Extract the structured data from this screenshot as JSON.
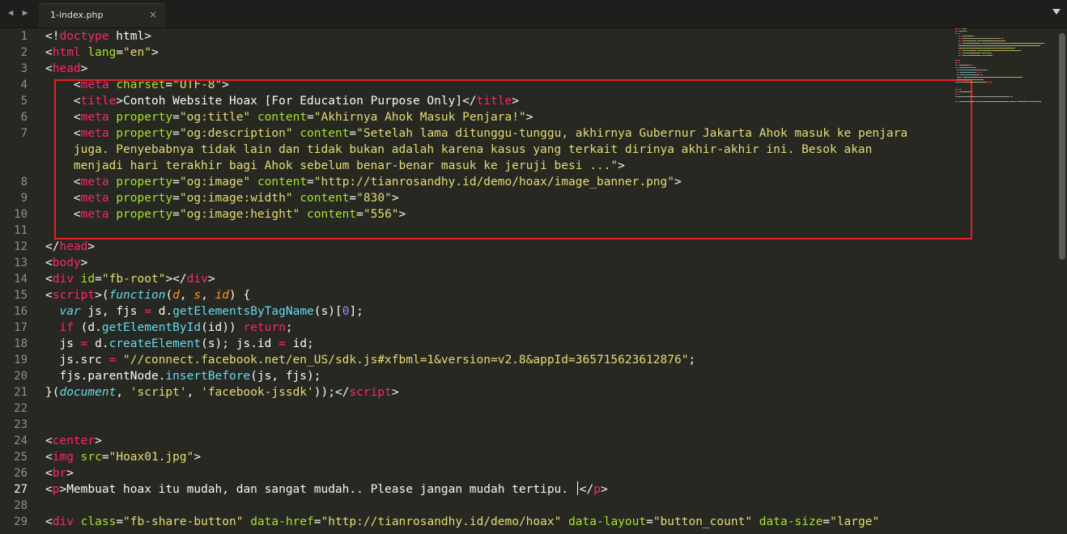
{
  "tab": {
    "filename": "1-index.php",
    "close_glyph": "×"
  },
  "line_numbers": [
    "1",
    "2",
    "3",
    "4",
    "5",
    "6",
    "7",
    "",
    "",
    "8",
    "9",
    "10",
    "11",
    "12",
    "13",
    "14",
    "15",
    "16",
    "17",
    "18",
    "19",
    "20",
    "21",
    "22",
    "23",
    "24",
    "25",
    "26",
    "27",
    "28",
    "29"
  ],
  "active_line_number": "27",
  "code_lines": [
    [
      [
        "p",
        "<!"
      ],
      [
        "t",
        "doctype"
      ],
      [
        "p",
        " html>"
      ]
    ],
    [
      [
        "p",
        "<"
      ],
      [
        "t",
        "html"
      ],
      [
        "p",
        " "
      ],
      [
        "a",
        "lang"
      ],
      [
        "p",
        "="
      ],
      [
        "s",
        "\"en\""
      ],
      [
        "p",
        ">"
      ]
    ],
    [
      [
        "p",
        "<"
      ],
      [
        "t",
        "head"
      ],
      [
        "p",
        ">"
      ]
    ],
    [
      [
        "p",
        "    <"
      ],
      [
        "t",
        "meta"
      ],
      [
        "p",
        " "
      ],
      [
        "a",
        "charset"
      ],
      [
        "p",
        "="
      ],
      [
        "s",
        "\"UTF-8\""
      ],
      [
        "p",
        ">"
      ]
    ],
    [
      [
        "p",
        "    <"
      ],
      [
        "t",
        "title"
      ],
      [
        "p",
        ">Contoh Website Hoax [For Education Purpose Only]</"
      ],
      [
        "t",
        "title"
      ],
      [
        "p",
        ">"
      ]
    ],
    [
      [
        "p",
        "    <"
      ],
      [
        "t",
        "meta"
      ],
      [
        "p",
        " "
      ],
      [
        "a",
        "property"
      ],
      [
        "p",
        "="
      ],
      [
        "s",
        "\"og:title\""
      ],
      [
        "p",
        " "
      ],
      [
        "a",
        "content"
      ],
      [
        "p",
        "="
      ],
      [
        "s",
        "\"Akhirnya Ahok Masuk Penjara!\""
      ],
      [
        "p",
        ">"
      ]
    ],
    [
      [
        "p",
        "    <"
      ],
      [
        "t",
        "meta"
      ],
      [
        "p",
        " "
      ],
      [
        "a",
        "property"
      ],
      [
        "p",
        "="
      ],
      [
        "s",
        "\"og:description\""
      ],
      [
        "p",
        " "
      ],
      [
        "a",
        "content"
      ],
      [
        "p",
        "="
      ],
      [
        "s",
        "\"Setelah lama ditunggu-tunggu, akhirnya Gubernur Jakarta Ahok masuk ke penjara"
      ]
    ],
    [
      [
        "s",
        "    juga. Penyebabnya tidak lain dan tidak bukan adalah karena kasus yang terkait dirinya akhir-akhir ini. Besok akan"
      ]
    ],
    [
      [
        "s",
        "    menjadi hari terakhir bagi Ahok sebelum benar-benar masuk ke jeruji besi ...\""
      ],
      [
        "p",
        ">"
      ]
    ],
    [
      [
        "p",
        "    <"
      ],
      [
        "t",
        "meta"
      ],
      [
        "p",
        " "
      ],
      [
        "a",
        "property"
      ],
      [
        "p",
        "="
      ],
      [
        "s",
        "\"og:image\""
      ],
      [
        "p",
        " "
      ],
      [
        "a",
        "content"
      ],
      [
        "p",
        "="
      ],
      [
        "s",
        "\"http://tianrosandhy.id/demo/hoax/image_banner.png\""
      ],
      [
        "p",
        ">"
      ]
    ],
    [
      [
        "p",
        "    <"
      ],
      [
        "t",
        "meta"
      ],
      [
        "p",
        " "
      ],
      [
        "a",
        "property"
      ],
      [
        "p",
        "="
      ],
      [
        "s",
        "\"og:image:width\""
      ],
      [
        "p",
        " "
      ],
      [
        "a",
        "content"
      ],
      [
        "p",
        "="
      ],
      [
        "s",
        "\"830\""
      ],
      [
        "p",
        ">"
      ]
    ],
    [
      [
        "p",
        "    <"
      ],
      [
        "t",
        "meta"
      ],
      [
        "p",
        " "
      ],
      [
        "a",
        "property"
      ],
      [
        "p",
        "="
      ],
      [
        "s",
        "\"og:image:height\""
      ],
      [
        "p",
        " "
      ],
      [
        "a",
        "content"
      ],
      [
        "p",
        "="
      ],
      [
        "s",
        "\"556\""
      ],
      [
        "p",
        ">"
      ]
    ],
    [],
    [
      [
        "p",
        "</"
      ],
      [
        "t",
        "head"
      ],
      [
        "p",
        ">"
      ]
    ],
    [
      [
        "p",
        "<"
      ],
      [
        "t",
        "body"
      ],
      [
        "p",
        ">"
      ]
    ],
    [
      [
        "p",
        "<"
      ],
      [
        "t",
        "div"
      ],
      [
        "p",
        " "
      ],
      [
        "a",
        "id"
      ],
      [
        "p",
        "="
      ],
      [
        "s",
        "\"fb-root\""
      ],
      [
        "p",
        "></"
      ],
      [
        "t",
        "div"
      ],
      [
        "p",
        ">"
      ]
    ],
    [
      [
        "p",
        "<"
      ],
      [
        "t",
        "script"
      ],
      [
        "p",
        ">("
      ],
      [
        "k",
        "function"
      ],
      [
        "p",
        "("
      ],
      [
        "v",
        "d"
      ],
      [
        "p",
        ", "
      ],
      [
        "v",
        "s"
      ],
      [
        "p",
        ", "
      ],
      [
        "v",
        "id"
      ],
      [
        "p",
        ") {"
      ]
    ],
    [
      [
        "p",
        "  "
      ],
      [
        "k",
        "var"
      ],
      [
        "p",
        " js, fjs "
      ],
      [
        "r",
        "="
      ],
      [
        "p",
        " d."
      ],
      [
        "f",
        "getElementsByTagName"
      ],
      [
        "p",
        "(s)["
      ],
      [
        "n",
        "0"
      ],
      [
        "p",
        "];"
      ]
    ],
    [
      [
        "p",
        "  "
      ],
      [
        "r",
        "if"
      ],
      [
        "p",
        " (d."
      ],
      [
        "f",
        "getElementById"
      ],
      [
        "p",
        "(id)) "
      ],
      [
        "r",
        "return"
      ],
      [
        "p",
        ";"
      ]
    ],
    [
      [
        "p",
        "  js "
      ],
      [
        "r",
        "="
      ],
      [
        "p",
        " d."
      ],
      [
        "f",
        "createElement"
      ],
      [
        "p",
        "(s); js.id "
      ],
      [
        "r",
        "="
      ],
      [
        "p",
        " id;"
      ]
    ],
    [
      [
        "p",
        "  js.src "
      ],
      [
        "r",
        "="
      ],
      [
        "p",
        " "
      ],
      [
        "s",
        "\"//connect.facebook.net/en_US/sdk.js#xfbml=1&version=v2.8&appId=365715623612876\""
      ],
      [
        "p",
        ";"
      ]
    ],
    [
      [
        "p",
        "  fjs.parentNode."
      ],
      [
        "f",
        "insertBefore"
      ],
      [
        "p",
        "(js, fjs);"
      ]
    ],
    [
      [
        "p",
        "}("
      ],
      [
        "k",
        "document"
      ],
      [
        "p",
        ", "
      ],
      [
        "s",
        "'script'"
      ],
      [
        "p",
        ", "
      ],
      [
        "s",
        "'facebook-jssdk'"
      ],
      [
        "p",
        "));</"
      ],
      [
        "t",
        "script"
      ],
      [
        "p",
        ">"
      ]
    ],
    [],
    [],
    [
      [
        "p",
        "<"
      ],
      [
        "t",
        "center"
      ],
      [
        "p",
        ">"
      ]
    ],
    [
      [
        "p",
        "<"
      ],
      [
        "t",
        "img"
      ],
      [
        "p",
        " "
      ],
      [
        "a",
        "src"
      ],
      [
        "p",
        "="
      ],
      [
        "s",
        "\"Hoax01.jpg\""
      ],
      [
        "p",
        ">"
      ]
    ],
    [
      [
        "p",
        "<"
      ],
      [
        "t",
        "br"
      ],
      [
        "p",
        ">"
      ]
    ],
    [
      [
        "p",
        "<"
      ],
      [
        "t",
        "p"
      ],
      [
        "p",
        ">Membuat hoax itu mudah, dan sangat mudah.. Please jangan mudah tertipu. "
      ],
      [
        "c",
        ""
      ],
      [
        "p",
        "</"
      ],
      [
        "t",
        "p"
      ],
      [
        "p",
        ">"
      ]
    ],
    [],
    [
      [
        "p",
        "<"
      ],
      [
        "t",
        "div"
      ],
      [
        "p",
        " "
      ],
      [
        "a",
        "class"
      ],
      [
        "p",
        "="
      ],
      [
        "s",
        "\"fb-share-button\""
      ],
      [
        "p",
        " "
      ],
      [
        "a",
        "data-href"
      ],
      [
        "p",
        "="
      ],
      [
        "s",
        "\"http://tianrosandhy.id/demo/hoax\""
      ],
      [
        "p",
        " "
      ],
      [
        "a",
        "data-layout"
      ],
      [
        "p",
        "="
      ],
      [
        "s",
        "\"button_count\""
      ],
      [
        "p",
        " "
      ],
      [
        "a",
        "data-size"
      ],
      [
        "p",
        "="
      ],
      [
        "s",
        "\"large\""
      ]
    ]
  ],
  "colors": {
    "background": "#272822",
    "tag": "#f92672",
    "attribute": "#a6e22e",
    "string": "#e6db74",
    "keyword": "#66d9ef",
    "number": "#ae81ff",
    "parameter": "#fd971f",
    "highlight_box": "#e3202a"
  },
  "icons": {
    "back": "chevron-left-icon",
    "forward": "chevron-right-icon",
    "overflow": "tab-overflow-icon"
  }
}
